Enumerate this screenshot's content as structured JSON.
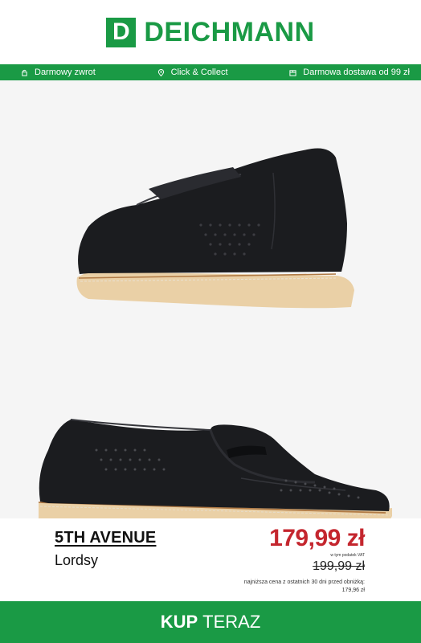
{
  "brand_logo": {
    "letter": "D",
    "name": "DEICHMANN",
    "color": "#1a9a45"
  },
  "benefits": [
    {
      "icon": "return-icon",
      "label": "Darmowy zwrot"
    },
    {
      "icon": "pin-icon",
      "label": "Click & Collect"
    },
    {
      "icon": "box-icon",
      "label": "Darmowa dostawa od 99 zł"
    }
  ],
  "product": {
    "brand": "5TH AVENUE",
    "name": "Lordsy",
    "price": "179,99 zł",
    "vat_note": "w tym podatek VAT",
    "old_price": "199,99 zł",
    "lowest_note_line1": "najniższa cena z ostatnich 30 dni przed obniżką:",
    "lowest_note_line2": "179,96 zł"
  },
  "cta": {
    "bold": "KUP",
    "rest": "TERAZ"
  },
  "colors": {
    "accent": "#1a9a45",
    "price": "#c4262e",
    "hero_bg": "#f5f5f5"
  }
}
